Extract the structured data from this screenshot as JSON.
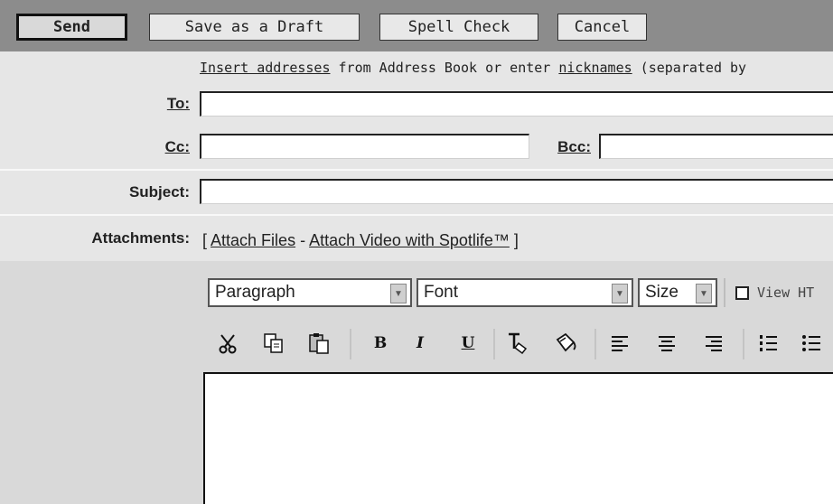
{
  "toolbar": {
    "send_label": "Send",
    "draft_label": "Save as a Draft",
    "spell_label": "Spell Check",
    "cancel_label": "Cancel"
  },
  "address_hint": {
    "link1": "Insert addresses",
    "text1": " from Address Book or enter ",
    "link2": "nicknames",
    "text2": " (separated by"
  },
  "fields": {
    "to_label": "To:",
    "cc_label": "Cc:",
    "bcc_label": "Bcc:",
    "subject_label": "Subject:",
    "attachments_label": "Attachments:"
  },
  "attachments": {
    "open_bracket": "[",
    "attach_files": "Attach Files",
    "dash": " - ",
    "attach_video": "Attach Video with Spotlife™",
    "close_bracket": "]"
  },
  "editor": {
    "paragraph": "Paragraph",
    "font": "Font",
    "size": "Size",
    "view_html": "View HT"
  },
  "icons": [
    "cut-icon",
    "copy-icon",
    "paste-icon",
    "bold-icon",
    "italic-icon",
    "underline-icon",
    "text-color-icon",
    "highlight-color-icon",
    "align-left-icon",
    "align-center-icon",
    "align-right-icon",
    "ordered-list-icon",
    "unordered-list-icon"
  ],
  "icon_glyphs": {
    "bold": "B",
    "italic": "I",
    "underline": "U"
  }
}
